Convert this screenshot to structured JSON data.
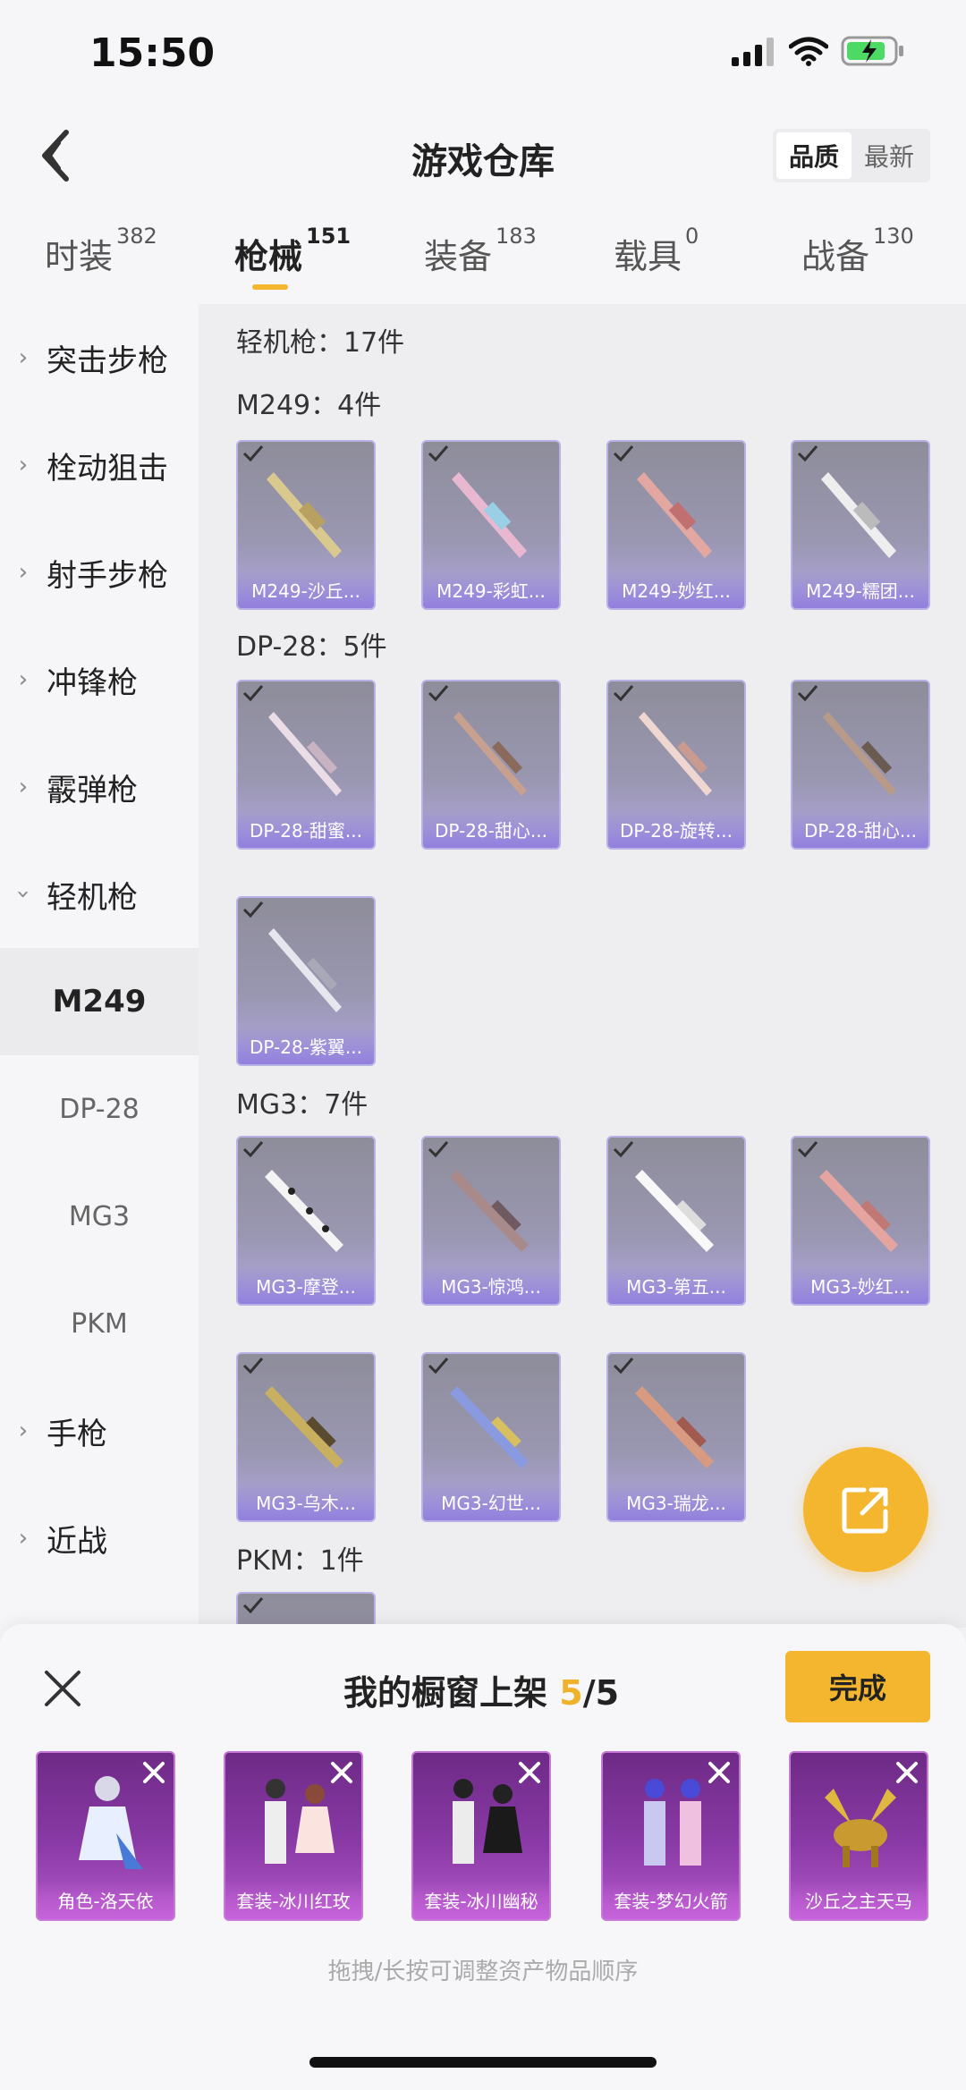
{
  "status": {
    "time": "15:50"
  },
  "header": {
    "title": "游戏仓库",
    "sort_options": [
      "品质",
      "最新"
    ]
  },
  "tabs": [
    {
      "label": "时装",
      "count": "382"
    },
    {
      "label": "枪械",
      "count": "151"
    },
    {
      "label": "装备",
      "count": "183"
    },
    {
      "label": "载具",
      "count": "0"
    },
    {
      "label": "战备",
      "count": "130"
    }
  ],
  "sidebar": {
    "categories": [
      "突击步枪",
      "栓动狙击",
      "射手步枪",
      "冲锋枪",
      "霰弹枪",
      "轻机枪"
    ],
    "subcategories": [
      "M249",
      "DP-28",
      "MG3",
      "PKM"
    ],
    "categories_after": [
      "手枪",
      "近战"
    ]
  },
  "content": {
    "category_title": "轻机枪：17件",
    "groups": [
      {
        "title": "M249：4件",
        "items": [
          "M249-沙丘...",
          "M249-彩虹...",
          "M249-妙红...",
          "M249-糯团..."
        ]
      },
      {
        "title": "DP-28：5件",
        "items": [
          "DP-28-甜蜜...",
          "DP-28-甜心...",
          "DP-28-旋转...",
          "DP-28-甜心...",
          "DP-28-紫翼..."
        ]
      },
      {
        "title": "MG3：7件",
        "items": [
          "MG3-摩登...",
          "MG3-惊鸿...",
          "MG3-第五...",
          "MG3-妙红...",
          "MG3-乌木...",
          "MG3-幻世...",
          "MG3-瑞龙..."
        ]
      },
      {
        "title": "PKM：1件",
        "items": [
          ""
        ]
      }
    ]
  },
  "panel": {
    "title_prefix": "我的橱窗上架",
    "count": "5",
    "total": "/5",
    "done_label": "完成",
    "items": [
      "角色-洛天依",
      "套装-冰川红玫",
      "套装-冰川幽秘",
      "套装-梦幻火箭",
      "沙丘之主天马"
    ],
    "hint": "拖拽/长按可调整资产物品顺序"
  },
  "colors": {
    "accent": "#f4b52f",
    "card_purple": "#b2a8e0",
    "shelf_purple": "#8a3aa6"
  }
}
